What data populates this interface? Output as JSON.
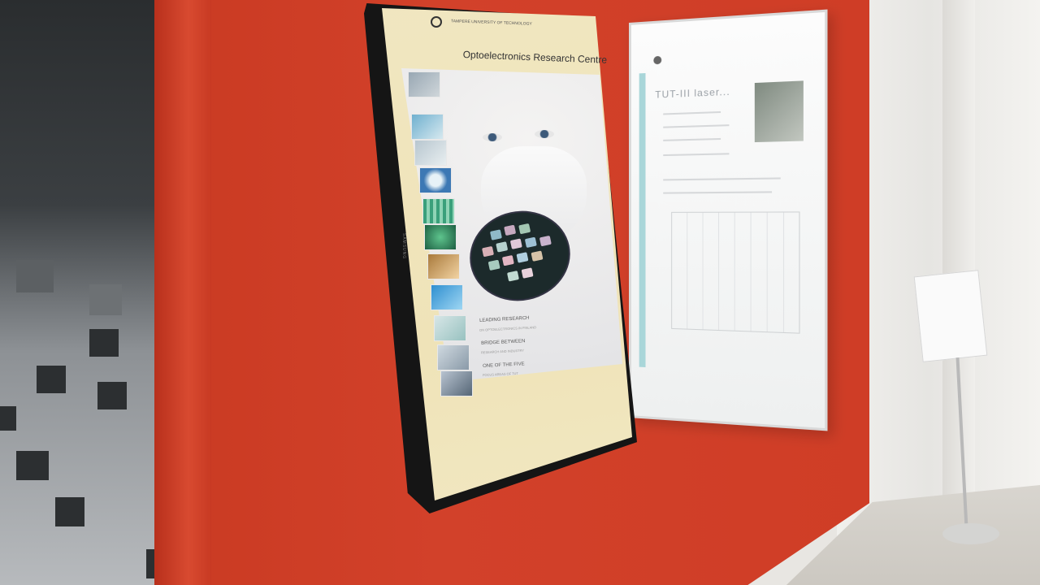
{
  "screen": {
    "university_text": "TAMPERE UNIVERSITY OF TECHNOLOGY",
    "title": "Optoelectronics Research Centre",
    "menu": [
      {
        "label": "LEADING RESEARCH",
        "sub": "ON OPTOELECTRONICS IN FINLAND"
      },
      {
        "label": "BRIDGE BETWEEN",
        "sub": "RESEARCH AND INDUSTRY"
      },
      {
        "label": "ONE OF THE FIVE",
        "sub": "FOCUS AREAS OF TUT"
      }
    ]
  },
  "monitor": {
    "brand": "SAMSUNG"
  },
  "poster": {
    "title": "TUT-III laser..."
  }
}
